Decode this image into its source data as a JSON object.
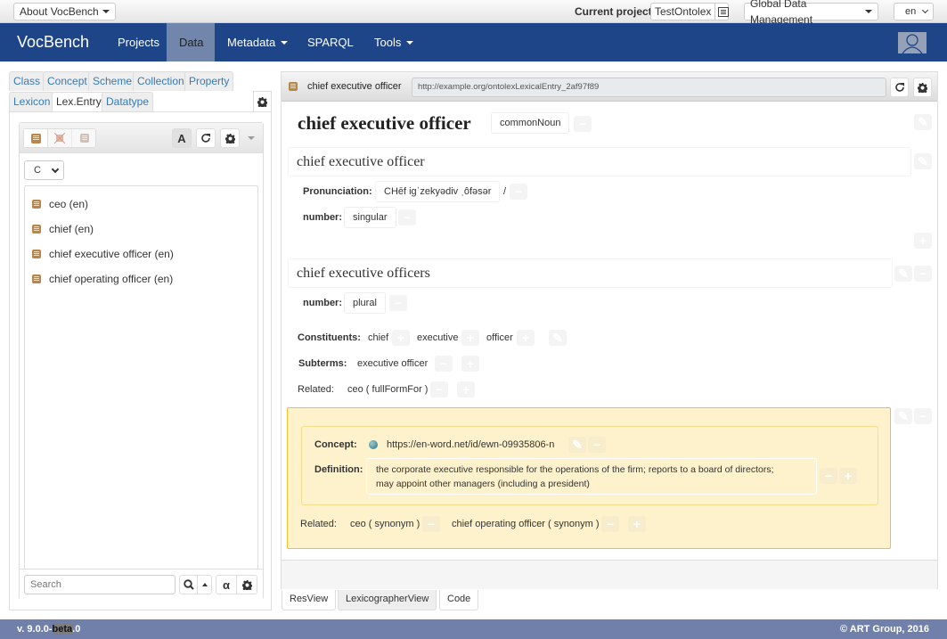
{
  "topbar": {
    "about_label": "About VocBench",
    "current_project_label": "Current project:",
    "current_project_value": "TestOntolex",
    "global_data_management_label": "Global Data Management",
    "language_value": "en"
  },
  "navbar": {
    "brand": "VocBench",
    "items": [
      {
        "label": "Projects",
        "active": false
      },
      {
        "label": "Data",
        "active": true
      },
      {
        "label": "Metadata",
        "dropdown": true
      },
      {
        "label": "SPARQL"
      },
      {
        "label": "Tools",
        "dropdown": true
      }
    ]
  },
  "left_panel": {
    "tabs_row1": [
      "Class",
      "Concept",
      "Scheme",
      "Collection",
      "Property"
    ],
    "tabs_row2": [
      "Lexicon",
      "Lex.Entry",
      "Datatype"
    ],
    "active_tab": "Lex.Entry",
    "index_select_value": "C",
    "entries": [
      "ceo (en)",
      "chief (en)",
      "chief executive officer (en)",
      "chief operating officer (en)"
    ],
    "search_placeholder": "Search",
    "alpha_button_label": "α",
    "a_button_label": "A"
  },
  "resource_view": {
    "header_title": "chief executive officer",
    "uri": "http://example.org/ontolexLexicalEntry_2af97f89",
    "lemma": "chief executive officer",
    "pos": "commonNoun",
    "forms": [
      {
        "written_rep": "chief executive officer",
        "pronunciation_label": "Pronunciation:",
        "pronunciation": "CHēf igˈzekyədiv ˌôfəsər",
        "slash": "/",
        "number_label": "number:",
        "number": "singular"
      },
      {
        "written_rep": "chief executive officers",
        "number_label": "number:",
        "number": "plural"
      }
    ],
    "constituents_label": "Constituents:",
    "constituents": [
      "chief",
      "executive",
      "officer"
    ],
    "subterms_label": "Subterms:",
    "subterms": [
      "executive officer"
    ],
    "related_label": "Related:",
    "related": [
      "ceo ( fullFormFor )"
    ],
    "sense": {
      "concept_label": "Concept:",
      "concept": "https://en-word.net/id/ewn-09935806-n",
      "definition_label": "Definition:",
      "definition_line1": "the corporate executive responsible for the operations of the firm; reports to a board of directors;",
      "definition_line2": "may appoint other managers (including a president)",
      "related_label": "Related:",
      "related": [
        "ceo ( synonym )",
        "chief operating officer ( synonym )"
      ]
    },
    "bottom_tabs": [
      "ResView",
      "LexicographerView",
      "Code"
    ],
    "active_bottom_tab": "LexicographerView"
  },
  "footer": {
    "version_prefix": "v. 9.0.0-",
    "version_highlight": "beta",
    "version_suffix": ".0",
    "copyright": "© ART Group, 2016"
  }
}
